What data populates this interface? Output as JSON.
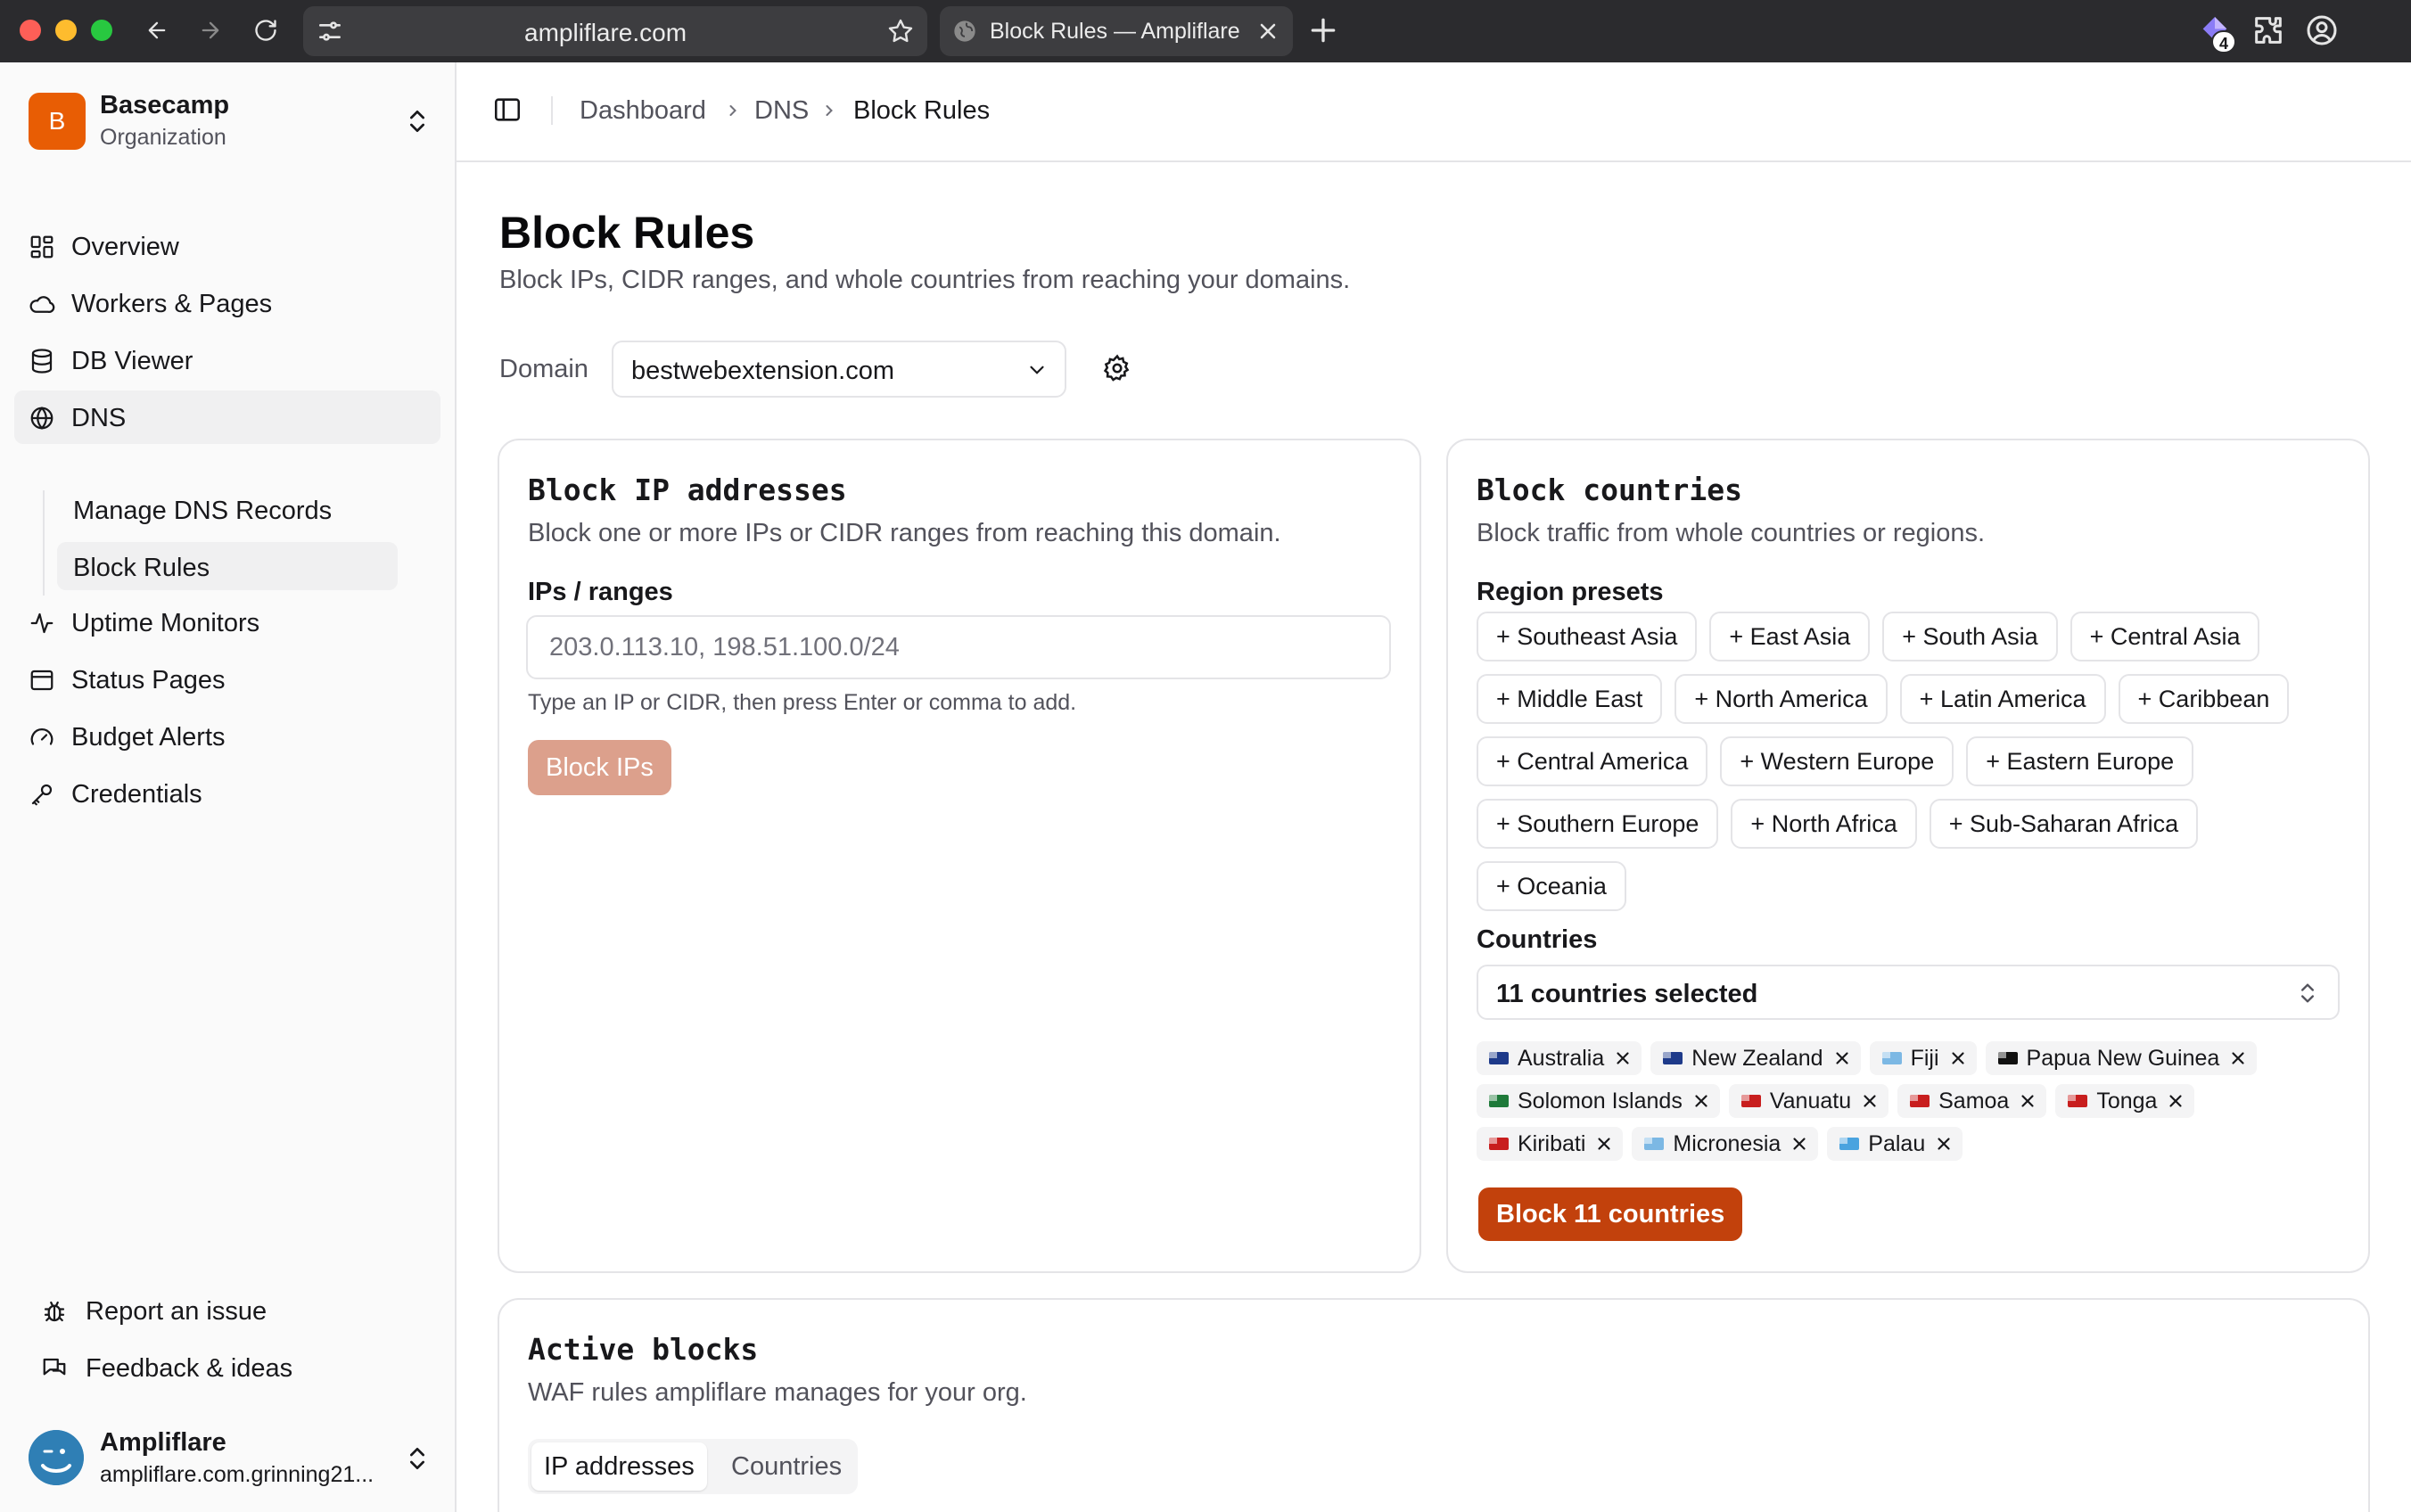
{
  "browser": {
    "url": "ampliflare.com",
    "tab_title": "Block Rules — Ampliflare",
    "extension_badge": "4"
  },
  "sidebar": {
    "org_initial": "B",
    "org_name": "Basecamp",
    "org_type": "Organization",
    "items": [
      {
        "label": "Overview",
        "icon": "grid-icon"
      },
      {
        "label": "Workers & Pages",
        "icon": "cloud-icon"
      },
      {
        "label": "DB Viewer",
        "icon": "database-icon"
      },
      {
        "label": "DNS",
        "icon": "globe-icon"
      },
      {
        "label": "Manage DNS Records"
      },
      {
        "label": "Block Rules"
      },
      {
        "label": "Uptime Monitors",
        "icon": "activity-icon"
      },
      {
        "label": "Status Pages",
        "icon": "panel-icon"
      },
      {
        "label": "Budget Alerts",
        "icon": "gauge-icon"
      },
      {
        "label": "Credentials",
        "icon": "key-icon"
      }
    ],
    "footer": [
      {
        "label": "Report an issue",
        "icon": "bug-icon"
      },
      {
        "label": "Feedback & ideas",
        "icon": "chat-icon"
      }
    ],
    "user_name": "Ampliflare",
    "user_email": "ampliflare.com.grinning21..."
  },
  "breadcrumb": [
    "Dashboard",
    "DNS",
    "Block Rules"
  ],
  "page": {
    "title": "Block Rules",
    "subtitle": "Block IPs, CIDR ranges, and whole countries from reaching your domains.",
    "domain_label": "Domain",
    "domain_value": "bestwebextension.com"
  },
  "block_ips": {
    "title": "Block IP addresses",
    "subtitle": "Block one or more IPs or CIDR ranges from reaching this domain.",
    "field_label": "IPs / ranges",
    "placeholder": "203.0.113.10, 198.51.100.0/24",
    "hint": "Type an IP or CIDR, then press Enter or comma to add.",
    "button": "Block IPs"
  },
  "block_countries": {
    "title": "Block countries",
    "subtitle": "Block traffic from whole countries or regions.",
    "presets_label": "Region presets",
    "presets": [
      "+ Southeast Asia",
      "+ East Asia",
      "+ South Asia",
      "+ Central Asia",
      "+ Middle East",
      "+ North America",
      "+ Latin America",
      "+ Caribbean",
      "+ Central America",
      "+ Western Europe",
      "+ Eastern Europe",
      "+ Southern Europe",
      "+ North Africa",
      "+ Sub-Saharan Africa",
      "+ Oceania"
    ],
    "countries_label": "Countries",
    "countries_value": "11 countries selected",
    "selected": [
      {
        "name": "Australia",
        "flag": "#1e3a8a"
      },
      {
        "name": "New Zealand",
        "flag": "#1e3a8a"
      },
      {
        "name": "Fiji",
        "flag": "#7cb8e4"
      },
      {
        "name": "Papua New Guinea",
        "flag": "#111111"
      },
      {
        "name": "Solomon Islands",
        "flag": "#1f7a3a"
      },
      {
        "name": "Vanuatu",
        "flag": "#c81e1e"
      },
      {
        "name": "Samoa",
        "flag": "#c81e1e"
      },
      {
        "name": "Tonga",
        "flag": "#c81e1e"
      },
      {
        "name": "Kiribati",
        "flag": "#c81e1e"
      },
      {
        "name": "Micronesia",
        "flag": "#7cb8e4"
      },
      {
        "name": "Palau",
        "flag": "#4aa3df"
      }
    ],
    "button": "Block 11 countries"
  },
  "active_blocks": {
    "title": "Active blocks",
    "subtitle": "WAF rules ampliflare manages for your org.",
    "tabs": [
      "IP addresses",
      "Countries"
    ]
  },
  "colors": {
    "accent": "#c2410c",
    "accent_disabled": "#dca08c",
    "org_logo": "#e85d04",
    "border": "#e4e4e7"
  }
}
